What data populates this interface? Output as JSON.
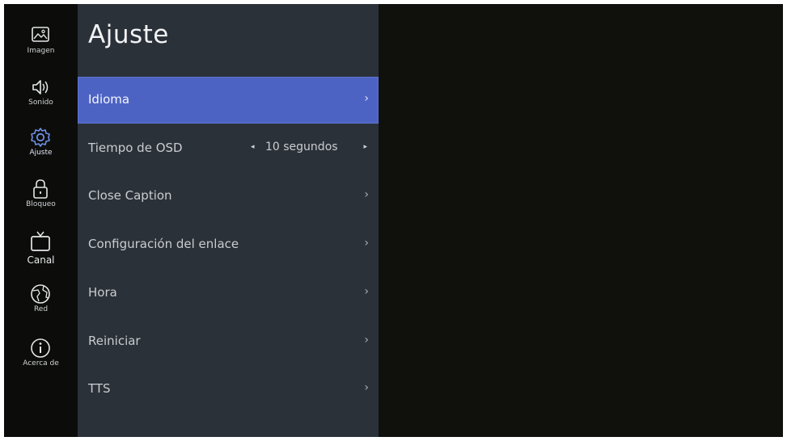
{
  "nav": {
    "items": [
      {
        "label": "Imagen",
        "icon": "image-icon"
      },
      {
        "label": "Sonido",
        "icon": "speaker-icon"
      },
      {
        "label": "Ajuste",
        "icon": "gear-icon"
      },
      {
        "label": "Bloqueo",
        "icon": "lock-icon"
      },
      {
        "label": "Canal",
        "icon": "tv-icon"
      },
      {
        "label": "Red",
        "icon": "globe-icon"
      },
      {
        "label": "Acerca de",
        "icon": "info-icon"
      }
    ],
    "active": "Ajuste"
  },
  "panel": {
    "title": "Ajuste",
    "items": [
      {
        "label": "Idioma",
        "selected": true,
        "chevron": "›"
      },
      {
        "label": "Tiempo de OSD",
        "value": "10 segundos",
        "arrow_left": "◂",
        "arrow_right": "▸"
      },
      {
        "label": "Close Caption",
        "chevron": "›"
      },
      {
        "label": "Configuración del enlace",
        "chevron": "›"
      },
      {
        "label": "Hora",
        "chevron": "›"
      },
      {
        "label": "Reiniciar",
        "chevron": "›"
      },
      {
        "label": "TTS",
        "chevron": "›"
      }
    ]
  },
  "colors": {
    "selected_bg": "#4d63c4",
    "panel_bg": "#2b3139",
    "screen_bg": "#10110d",
    "active_icon": "#6f8fe8"
  }
}
